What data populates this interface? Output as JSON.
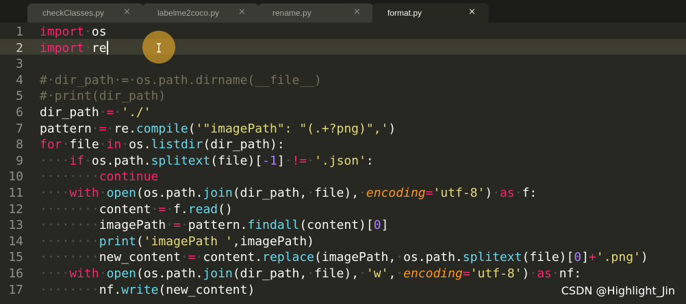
{
  "tabs": [
    {
      "label": "checkClasses.py",
      "active": false
    },
    {
      "label": "labelme2coco.py",
      "active": false
    },
    {
      "label": "rename.py",
      "active": false
    },
    {
      "label": "format.py",
      "active": true
    }
  ],
  "close_glyph": "×",
  "line_numbers": [
    "1",
    "2",
    "3",
    "4",
    "5",
    "6",
    "7",
    "8",
    "9",
    "10",
    "11",
    "12",
    "13",
    "14",
    "15",
    "16",
    "17"
  ],
  "current_line": 2,
  "code_lines": [
    "import os",
    "import re",
    "",
    "# dir_path = os.path.dirname(__file__)",
    "# print(dir_path)",
    "dir_path = './'",
    "pattern = re.compile('\"imagePath\": \"(.+?png)\",')",
    "for file in os.listdir(dir_path):",
    "    if os.path.splitext(file)[-1] != '.json':",
    "        continue",
    "    with open(os.path.join(dir_path, file), encoding='utf-8') as f:",
    "        content = f.read()",
    "        imagePath = pattern.findall(content)[0]",
    "        print('imagePath ',imagePath)",
    "        new_content = content.replace(imagePath, os.path.splitext(file)[0]+'.png')",
    "    with open(os.path.join(dir_path, file), 'w', encoding='utf-8') as nf:",
    "        nf.write(new_content)"
  ],
  "watermark": "CSDN @Highlight_Jin",
  "colors": {
    "background": "#272822",
    "keyword": "#f92672",
    "function": "#66d9ef",
    "string": "#e6db74",
    "comment": "#75715e",
    "number": "#ae81ff",
    "argument": "#fd971f",
    "cursor_highlight": "#d29b28"
  },
  "icons": {
    "tab_close": "close-icon",
    "mouse_cursor": "text-cursor-icon"
  }
}
